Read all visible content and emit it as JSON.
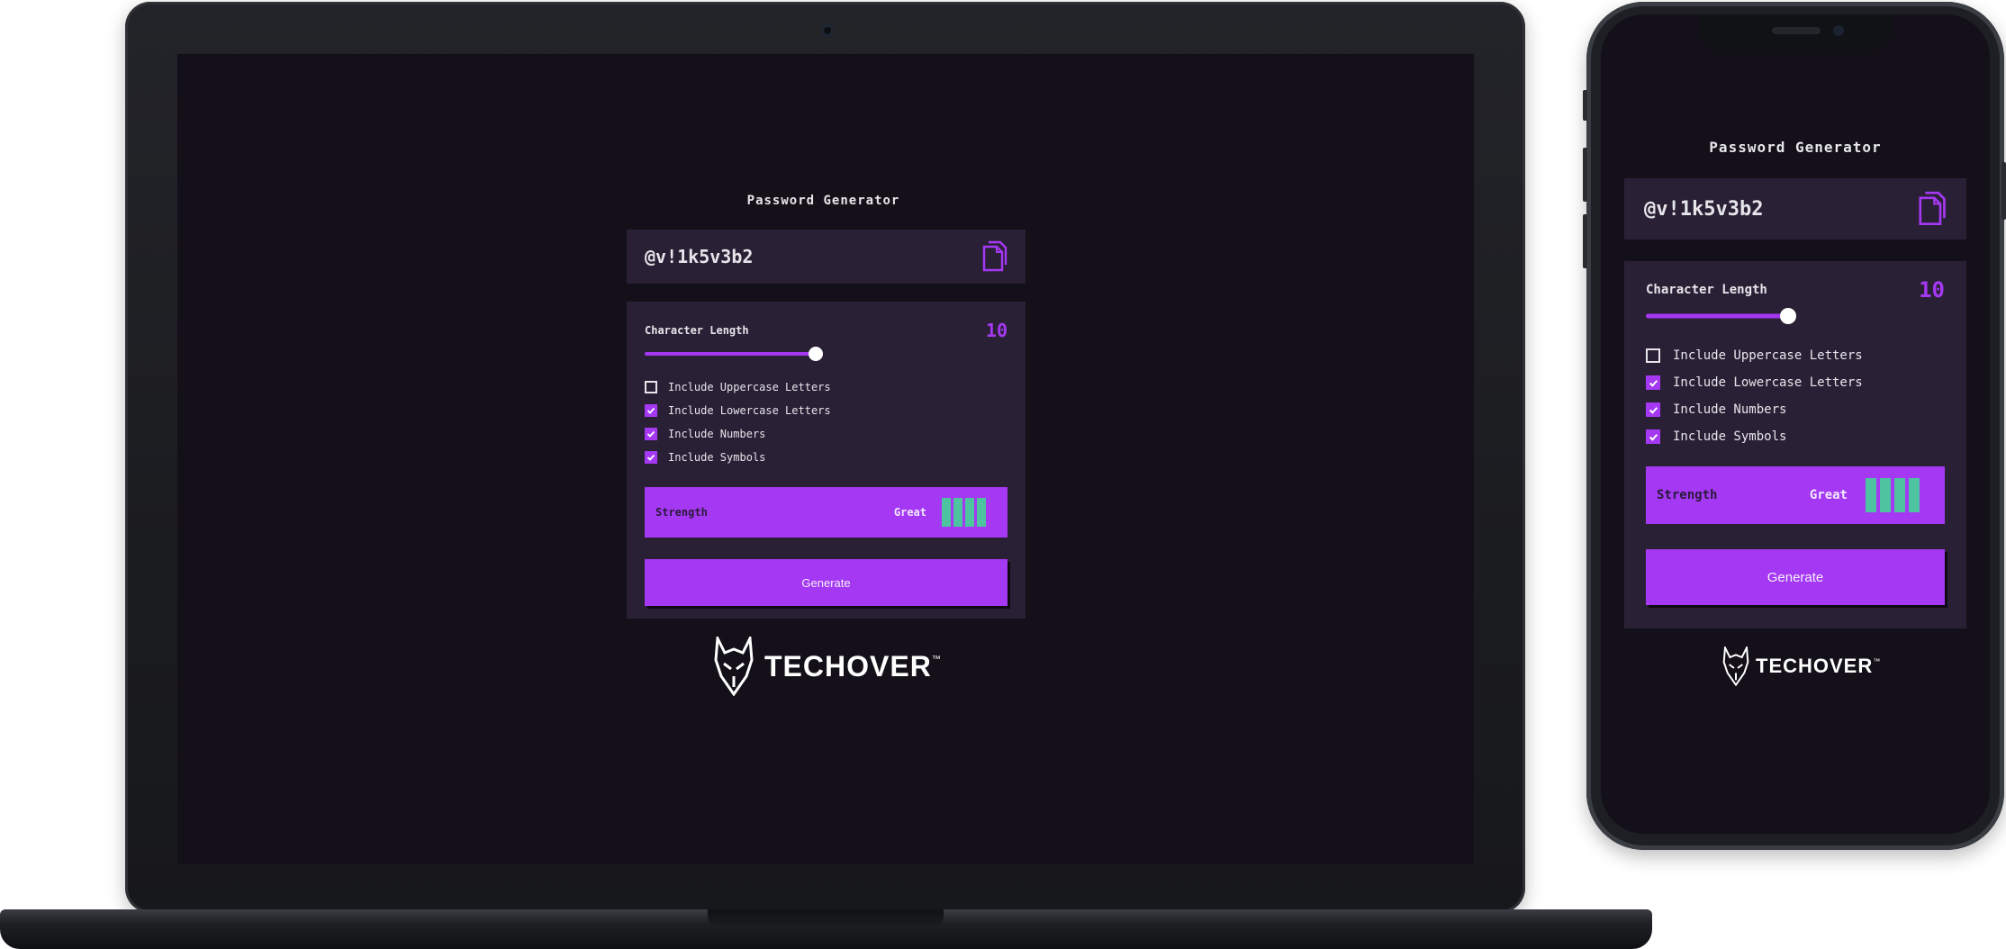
{
  "app": {
    "title": "Password Generator",
    "password": "@v!1k5v3b2",
    "copy_icon": "copy-icon",
    "length_label": "Character Length",
    "length_value": "10",
    "length_fraction": 0.5,
    "options": [
      {
        "label": "Include Uppercase Letters",
        "checked": false
      },
      {
        "label": "Include Lowercase Letters",
        "checked": true
      },
      {
        "label": "Include Numbers",
        "checked": true
      },
      {
        "label": "Include Symbols",
        "checked": true
      }
    ],
    "strength_label": "Strength",
    "strength_rating": "Great",
    "strength_level": 4,
    "strength_max": 4,
    "generate_label": "Generate",
    "logo_text": "TECHOVER",
    "logo_tm": "™"
  },
  "colors": {
    "accent": "#a538f2",
    "background": "#141019",
    "panel": "#2a2036",
    "strength_bar": "#4ec3a0",
    "text": "#e6e5ea"
  }
}
